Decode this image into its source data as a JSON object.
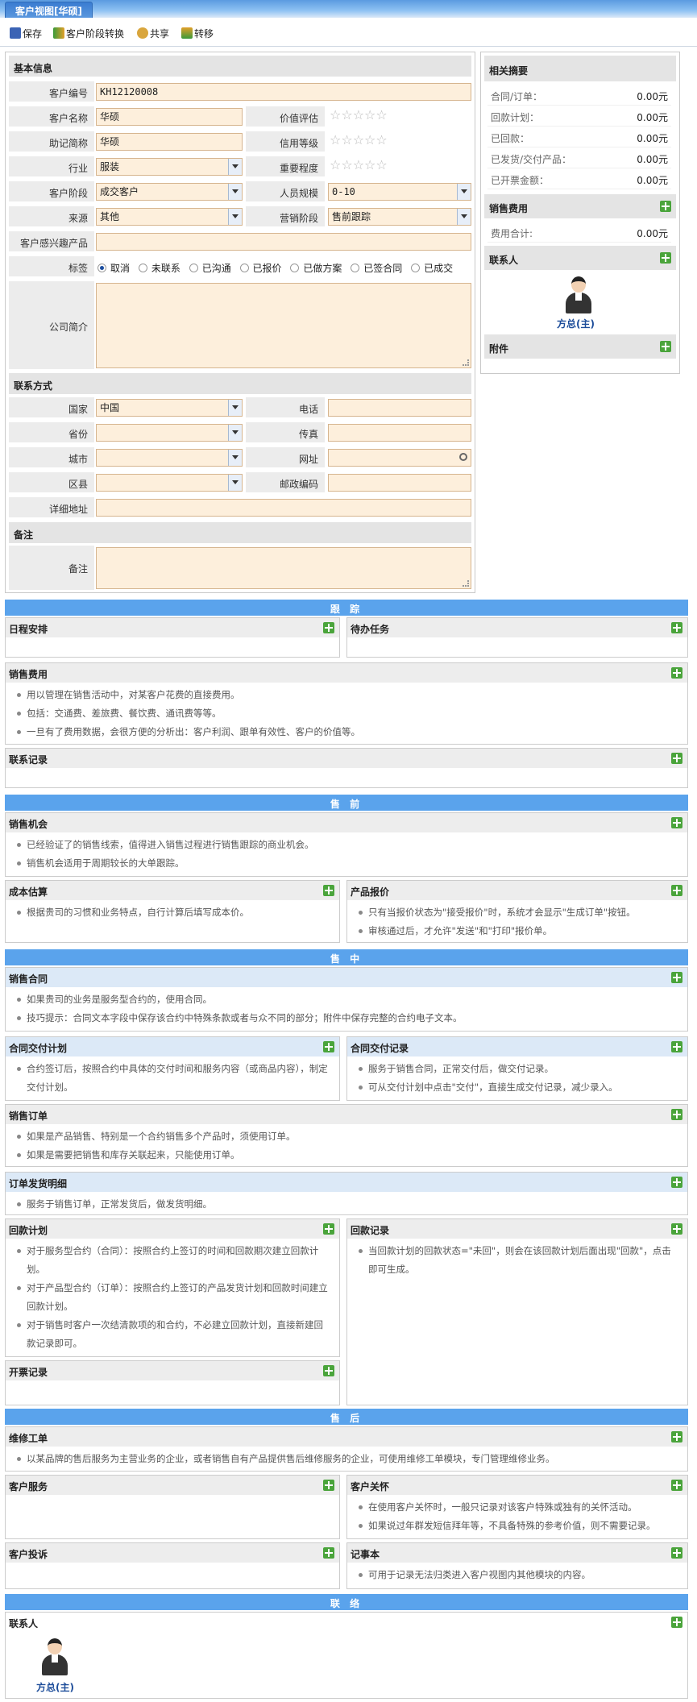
{
  "window": {
    "tab_title": "客户视图[华硕]"
  },
  "toolbar": {
    "save": "保存",
    "stage_convert": "客户阶段转换",
    "share": "共享",
    "transfer": "转移"
  },
  "basic": {
    "section": "基本信息",
    "code_label": "客户编号",
    "code": "KH12120008",
    "name_label": "客户名称",
    "name": "华硕",
    "value_label": "价值评估",
    "short_label": "助记简称",
    "short": "华硕",
    "credit_label": "信用等级",
    "industry_label": "行业",
    "industry": "服装",
    "importance_label": "重要程度",
    "stage_label": "客户阶段",
    "stage": "成交客户",
    "staff_label": "人员规模",
    "staff": "0-10",
    "source_label": "来源",
    "source": "其他",
    "sales_stage_label": "营销阶段",
    "sales_stage": "售前跟踪",
    "interest_label": "客户感兴趣产品",
    "interest": "",
    "tag_label": "标签",
    "tags": [
      "取消",
      "未联系",
      "已沟通",
      "已报价",
      "已做方案",
      "已签合同",
      "已成交"
    ],
    "tag_selected": "取消",
    "intro_label": "公司简介",
    "intro": ""
  },
  "contact": {
    "section": "联系方式",
    "country_label": "国家",
    "country": "中国",
    "phone_label": "电话",
    "phone": "",
    "province_label": "省份",
    "province": "",
    "fax_label": "传真",
    "fax": "",
    "city_label": "城市",
    "city": "",
    "web_label": "网址",
    "web": "",
    "district_label": "区县",
    "district": "",
    "zip_label": "邮政编码",
    "zip": "",
    "addr_label": "详细地址",
    "addr": ""
  },
  "remark": {
    "section": "备注",
    "label": "备注",
    "value": ""
  },
  "summary": {
    "title": "相关摘要",
    "rows": [
      {
        "k": "合同/订单：",
        "v": "0.00元"
      },
      {
        "k": "回款计划：",
        "v": "0.00元"
      },
      {
        "k": "已回款：",
        "v": "0.00元"
      },
      {
        "k": "已发货/交付产品：",
        "v": "0.00元"
      },
      {
        "k": "已开票金额：",
        "v": "0.00元"
      }
    ],
    "fee_title": "销售费用",
    "fee_k": "费用合计:",
    "fee_v": "0.00元",
    "contact_title": "联系人",
    "contact_name": "方总(主)",
    "attach_title": "附件"
  },
  "track": {
    "band": "跟 踪",
    "schedule": "日程安排",
    "todo": "待办任务",
    "fee": "销售费用",
    "fee_items": [
      "用以管理在销售活动中，对某客户花费的直接费用。",
      "包括：交通费、差旅费、餐饮费、通讯费等等。",
      "一旦有了费用数据，会很方便的分析出：客户利润、跟单有效性、客户的价值等。"
    ],
    "record": "联系记录"
  },
  "pre": {
    "band": "售 前",
    "opp": "销售机会",
    "opp_items": [
      "已经验证了的销售线索，值得进入销售过程进行销售跟踪的商业机会。",
      "销售机会适用于周期较长的大单跟踪。"
    ],
    "cost": "成本估算",
    "cost_items": [
      "根据贵司的习惯和业务特点，自行计算后填写成本价。"
    ],
    "quote": "产品报价",
    "quote_items": [
      "只有当报价状态为\"接受报价\"时，系统才会显示\"生成订单\"按钮。",
      "审核通过后，才允许\"发送\"和\"打印\"报价单。"
    ]
  },
  "mid": {
    "band": "售 中",
    "contract": "销售合同",
    "contract_items": [
      "如果贵司的业务是服务型合约的，使用合同。",
      "技巧提示：合同文本字段中保存该合约中特殊条款或者与众不同的部分；附件中保存完整的合约电子文本。"
    ],
    "plan": "合同交付计划",
    "plan_items": [
      "合约签订后，按照合约中具体的交付时间和服务内容（或商品内容），制定交付计划。"
    ],
    "deliver": "合同交付记录",
    "deliver_items": [
      "服务于销售合同，正常交付后，做交付记录。",
      "可从交付计划中点击\"交付\"，直接生成交付记录，减少录入。"
    ],
    "order": "销售订单",
    "order_items": [
      "如果是产品销售、特别是一个合约销售多个产品时，须使用订单。",
      "如果是需要把销售和库存关联起来，只能使用订单。"
    ],
    "ship": "订单发货明细",
    "ship_items": [
      "服务于销售订单，正常发货后，做发货明细。"
    ],
    "payplan": "回款计划",
    "payplan_items": [
      "对于服务型合约（合同）：按照合约上签订的时间和回款期次建立回款计划。",
      "对于产品型合约（订单）：按照合约上签订的产品发货计划和回款时间建立回款计划。",
      "对于销售时客户一次结清款项的和合约，不必建立回款计划，直接新建回款记录即可。"
    ],
    "payrec": "回款记录",
    "payrec_items": [
      "当回款计划的回款状态=\"未回\"，则会在该回款计划后面出现\"回款\"，点击即可生成。"
    ],
    "invoice": "开票记录"
  },
  "after": {
    "band": "售 后",
    "repair": "维修工单",
    "repair_items": [
      "以某品牌的售后服务为主营业务的企业，或者销售自有产品提供售后维修服务的企业，可使用维修工单模块，专门管理维修业务。"
    ],
    "service": "客户服务",
    "care": "客户关怀",
    "care_items": [
      "在使用客户关怀时，一般只记录对该客户特殊或独有的关怀活动。",
      "如果说过年群发短信拜年等，不具备特殊的参考价值，则不需要记录。"
    ],
    "complaint": "客户投诉",
    "memo": "记事本",
    "memo_items": [
      "可用于记录无法归类进入客户视图内其他模块的内容。"
    ]
  },
  "link": {
    "band": "联 络",
    "contact": "联系人",
    "contact_name": "方总(主)"
  },
  "colors": {
    "band": "#5aa3ec",
    "field": "#fdefdc",
    "plus": "#4aa43b"
  },
  "icons": [
    "save-icon",
    "stage-convert-icon",
    "share-icon",
    "transfer-icon",
    "plus-icon",
    "star-icon",
    "dropdown-arrow-icon",
    "search-icon",
    "avatar-icon"
  ]
}
